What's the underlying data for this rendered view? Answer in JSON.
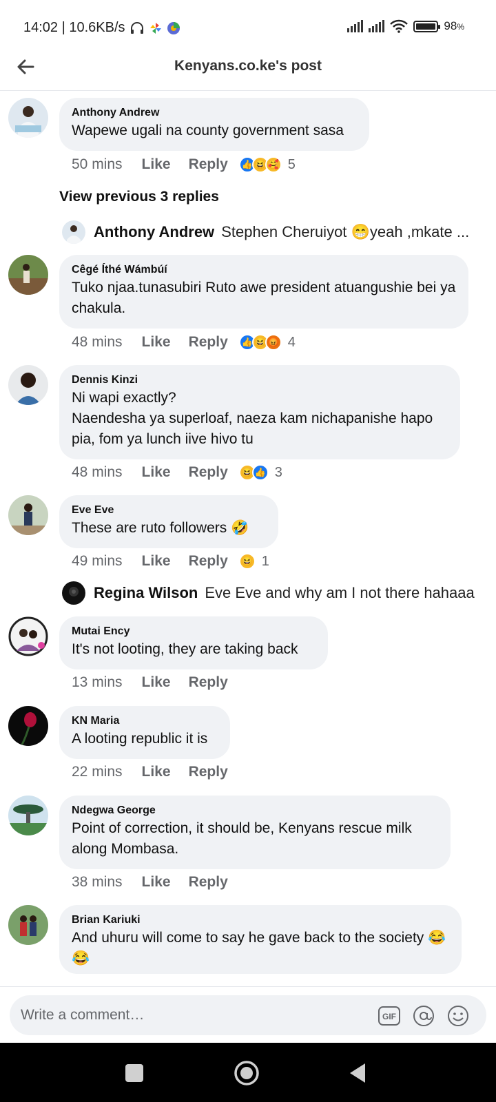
{
  "status": {
    "time_speed": "14:02 | 10.6KB/s",
    "battery": "98"
  },
  "header": {
    "title": "Kenyans.co.ke's post"
  },
  "actions": {
    "like": "Like",
    "reply": "Reply"
  },
  "view_previous": "View previous 3 replies",
  "comments": [
    {
      "name": "Anthony Andrew",
      "text": "Wapewe ugali na county government sasa",
      "time": "50 mins",
      "reaction_count": "5"
    },
    {
      "name": "Cêgé Íthé Wámbúí",
      "text": "Tuko njaa.tunasubiri Ruto awe president atuangushie bei ya chakula.",
      "time": "48 mins",
      "reaction_count": "4"
    },
    {
      "name": "Dennis Kinzi",
      "text": "Ni wapi exactly?\nNaendesha ya superloaf, naeza kam nichapanishe hapo pia, fom ya lunch iive hivo tu",
      "time": "48 mins",
      "reaction_count": "3"
    },
    {
      "name": "Eve Eve",
      "text": "These are ruto followers 🤣",
      "time": "49 mins",
      "reaction_count": "1"
    },
    {
      "name": "Mutai Ency",
      "text": "It's not looting, they are taking back",
      "time": "13 mins"
    },
    {
      "name": "KN Maria",
      "text": "A looting republic it is",
      "time": "22 mins"
    },
    {
      "name": "Ndegwa George",
      "text": "Point of correction, it should be, Kenyans rescue milk along Mombasa.",
      "time": "38 mins"
    },
    {
      "name": "Brian Kariuki",
      "text": "And uhuru will come to say he gave back to the society 😂😂"
    }
  ],
  "reply_previews": [
    {
      "name": "Anthony Andrew",
      "text": "Stephen Cheruiyot 😁yeah ,mkate ..."
    },
    {
      "name": "Regina Wilson",
      "text": "Eve Eve and why am I not there hahaaa"
    }
  ],
  "composer": {
    "placeholder": "Write a comment…",
    "gif_label": "GIF"
  },
  "colors": {
    "bubble": "#f0f2f5",
    "like_blue": "#1877f2",
    "muted": "#65676b"
  }
}
